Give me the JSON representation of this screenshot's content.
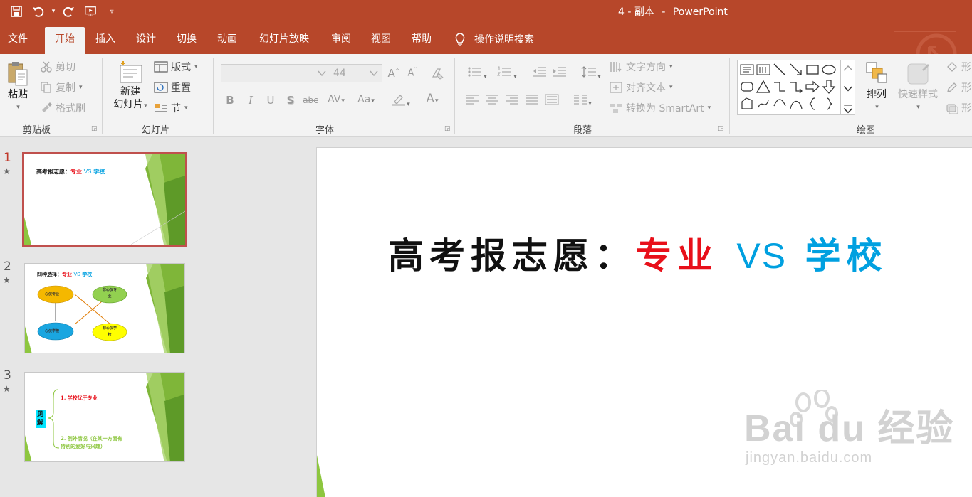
{
  "window": {
    "doc_name": "4 - 副本",
    "separator": "-",
    "app_name": "PowerPoint"
  },
  "tabs": [
    {
      "label": "文件"
    },
    {
      "label": "开始"
    },
    {
      "label": "插入"
    },
    {
      "label": "设计"
    },
    {
      "label": "切换"
    },
    {
      "label": "动画"
    },
    {
      "label": "幻灯片放映"
    },
    {
      "label": "审阅"
    },
    {
      "label": "视图"
    },
    {
      "label": "帮助"
    }
  ],
  "active_tab": "开始",
  "tell_me": "操作说明搜索",
  "ribbon": {
    "clipboard": {
      "label": "剪贴板",
      "paste": "粘贴",
      "cut": "剪切",
      "copy": "复制",
      "format_painter": "格式刷"
    },
    "slides": {
      "label": "幻灯片",
      "new_slide_line1": "新建",
      "new_slide_line2": "幻灯片",
      "layout": "版式",
      "reset": "重置",
      "section": "节"
    },
    "font": {
      "label": "字体",
      "font_name": "",
      "font_size": "44",
      "bold": "B",
      "italic": "I",
      "underline": "U",
      "shadow": "S",
      "strike": "abc",
      "spacing": "AV",
      "case": "Aa",
      "grow": "A",
      "shrink": "A",
      "color": "A"
    },
    "paragraph": {
      "label": "段落",
      "text_direction": "文字方向",
      "align_text": "对齐文本",
      "smartart": "转换为 SmartArt"
    },
    "drawing": {
      "label": "绘图",
      "arrange": "排列",
      "quick_styles": "快速样式",
      "shape_fill": "形",
      "shape_outline": "形",
      "shape_effects": "形"
    }
  },
  "slides": [
    {
      "number": "1",
      "selected": true,
      "title_black": "高考报志愿：",
      "title_red": "专业",
      "title_vs": "VS",
      "title_blue": "学校"
    },
    {
      "number": "2",
      "selected": false,
      "title_black": "四种选择：",
      "title_red": "专业",
      "title_vs": "VS",
      "title_blue": "学校",
      "ellipses": [
        {
          "text": "心仪专业",
          "color": "#f5b800"
        },
        {
          "text": "非心仪专业",
          "color": "#92d050"
        },
        {
          "text": "心仪学校",
          "color": "#1aa6e0"
        },
        {
          "text": "非心仪学校",
          "color": "#ffff00"
        }
      ]
    },
    {
      "number": "3",
      "selected": false,
      "label_box": "见解",
      "point1": "1. 学校优于专业",
      "point2_line1": "2. 例外情况（在某一方面有",
      "point2_line2": "特别的爱好与兴趣）"
    }
  ],
  "star": "★",
  "main_slide": {
    "title_black": "高考报志愿：",
    "title_red": "专业",
    "title_vs": "VS",
    "title_blue": "学校"
  },
  "watermark": {
    "main": "Bai du 经验",
    "sub": "jingyan.baidu.com"
  },
  "colors": {
    "titlebar": "#b7472a",
    "ribbon": "#f3f3f3",
    "accent_red": "#e8101a",
    "accent_blue": "#00a0e0",
    "slide_green": "#8dc63f"
  }
}
